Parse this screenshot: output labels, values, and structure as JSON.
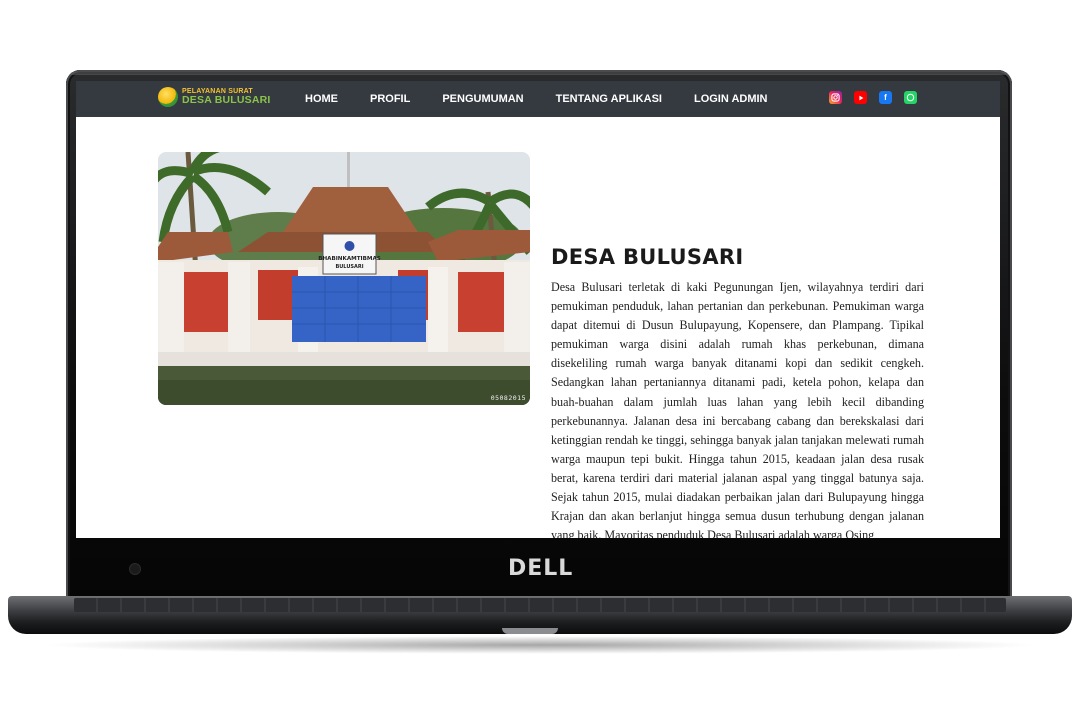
{
  "device": {
    "brand_logo": "DELL"
  },
  "site": {
    "logo": {
      "line1": "PELAYANAN SURAT",
      "line2": "DESA BULUSARI"
    },
    "nav": [
      {
        "label": "HOME"
      },
      {
        "label": "PROFIL"
      },
      {
        "label": "PENGUMUMAN"
      },
      {
        "label": "TENTANG APLIKASI"
      },
      {
        "label": "LOGIN ADMIN"
      }
    ],
    "social": [
      {
        "icon": "instagram-icon",
        "color": "#e91e63"
      },
      {
        "icon": "youtube-icon",
        "color": "#ff0000"
      },
      {
        "icon": "facebook-icon",
        "color": "#1877f2"
      },
      {
        "icon": "whatsapp-icon",
        "color": "#25d366"
      }
    ],
    "colors": {
      "navbar": "#343a40",
      "logo_yellow": "#f4c430",
      "logo_green": "#8bc34a"
    }
  },
  "hero": {
    "photo_sign_line1": "BHABINKAMTIBMAS",
    "photo_sign_line2": "BULUSARI",
    "photo_date_stamp": "05082015"
  },
  "article": {
    "title": "DESA BULUSARI",
    "body": "Desa Bulusari terletak di kaki Pegunungan Ijen, wilayahnya terdiri dari pemukiman penduduk, lahan pertanian dan perkebunan. Pemukiman warga dapat ditemui di Dusun Bulupayung, Kopensere, dan Plampang. Tipikal pemukiman warga disini adalah rumah khas perkebunan, dimana disekeliling rumah warga banyak ditanami kopi dan sedikit cengkeh. Sedangkan lahan pertaniannya ditanami padi, ketela pohon, kelapa dan buah-buahan dalam jumlah luas lahan yang lebih kecil dibanding perkebunannya. Jalanan desa ini bercabang cabang dan berekskalasi dari ketinggian rendah ke tinggi, sehingga banyak jalan tanjakan melewati rumah warga maupun tepi bukit. Hingga tahun 2015, keadaan jalan desa rusak berat, karena terdiri dari material jalanan aspal yang tinggal batunya saja. Sejak tahun 2015, mulai diadakan perbaikan jalan dari Bulupayung hingga Krajan dan akan berlanjut hingga semua dusun terhubung dengan jalanan yang baik. Mayoritas penduduk Desa Bulusari adalah warga Osing"
  }
}
